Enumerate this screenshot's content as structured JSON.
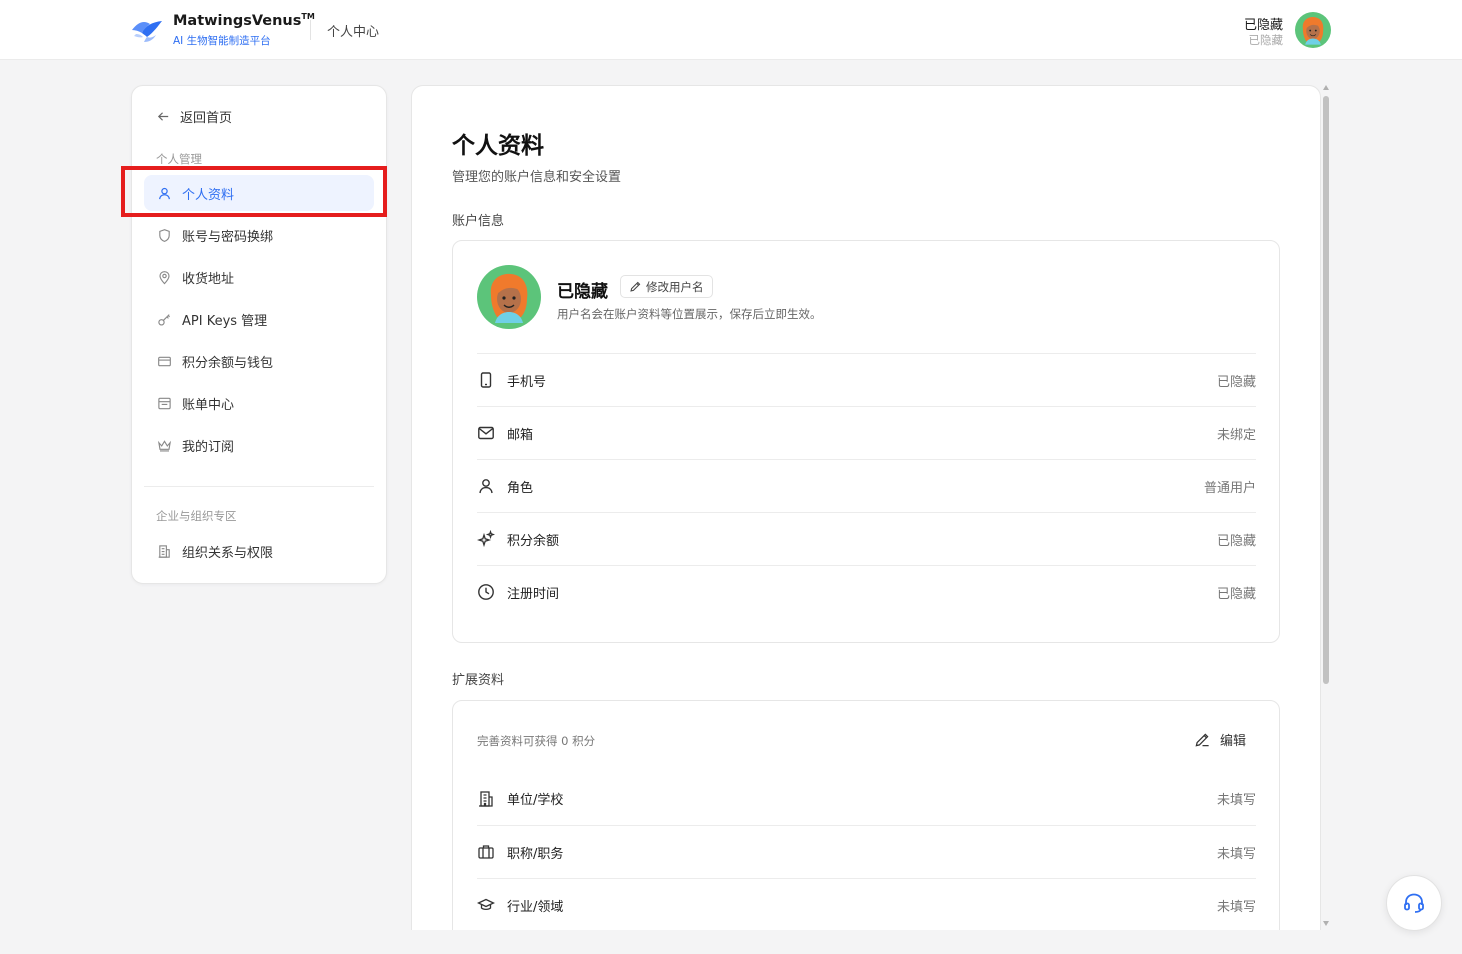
{
  "header": {
    "brand_name": "MatwingsVenus",
    "brand_tm": "TM",
    "brand_sub": "AI 生物智能制造平台",
    "section": "个人中心",
    "user_name": "已隐藏",
    "user_sub": "已隐藏"
  },
  "sidebar": {
    "back_label": "返回首页",
    "group_personal": "个人管理",
    "items": [
      {
        "label": "个人资料",
        "icon": "user-icon",
        "active": true
      },
      {
        "label": "账号与密码换绑",
        "icon": "shield-icon"
      },
      {
        "label": "收货地址",
        "icon": "location-pin-icon"
      },
      {
        "label": "API Keys 管理",
        "icon": "key-icon"
      },
      {
        "label": "积分余额与钱包",
        "icon": "wallet-card-icon"
      },
      {
        "label": "账单中心",
        "icon": "bill-icon"
      },
      {
        "label": "我的订阅",
        "icon": "crown-icon"
      }
    ],
    "group_org": "企业与组织专区",
    "org_items": [
      {
        "label": "组织关系与权限",
        "icon": "building-icon"
      }
    ]
  },
  "main": {
    "title": "个人资料",
    "description": "管理您的账户信息和安全设置",
    "account_section_title": "账户信息",
    "profile": {
      "name": "已隐藏",
      "rename_label": "修改用户名",
      "hint": "用户名会在账户资料等位置展示，保存后立即生效。"
    },
    "account_rows": [
      {
        "label": "手机号",
        "value": "已隐藏",
        "icon": "phone-icon"
      },
      {
        "label": "邮箱",
        "value": "未绑定",
        "icon": "mail-icon"
      },
      {
        "label": "角色",
        "value": "普通用户",
        "icon": "user-icon"
      },
      {
        "label": "积分余额",
        "value": "已隐藏",
        "icon": "sparkles-icon"
      },
      {
        "label": "注册时间",
        "value": "已隐藏",
        "icon": "clock-icon"
      }
    ],
    "ext_section_title": "扩展资料",
    "ext_hint": "完善资料可获得 0 积分",
    "edit_label": "编辑",
    "ext_rows": [
      {
        "label": "单位/学校",
        "value": "未填写",
        "icon": "building-icon"
      },
      {
        "label": "职称/职务",
        "value": "未填写",
        "icon": "briefcase-icon"
      },
      {
        "label": "行业/领域",
        "value": "未填写",
        "icon": "graduation-cap-icon"
      }
    ]
  },
  "colors": {
    "accent": "#2f6ff2",
    "active_bg": "#eef3ff",
    "highlight": "#e51d1d"
  }
}
